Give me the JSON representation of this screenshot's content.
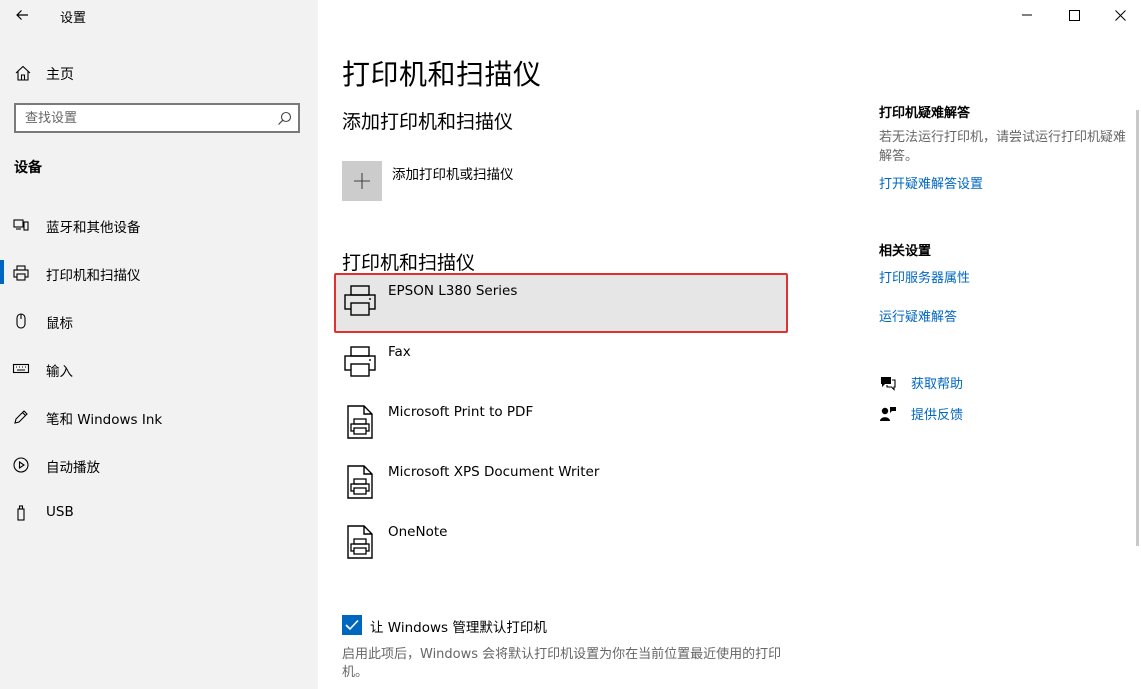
{
  "window": {
    "title": "设置"
  },
  "sidebar": {
    "home_label": "主页",
    "search_placeholder": "查找设置",
    "section_label": "设备",
    "items": [
      {
        "label": "蓝牙和其他设备",
        "icon": "bluetooth-icon"
      },
      {
        "label": "打印机和扫描仪",
        "icon": "printer-icon",
        "active": true
      },
      {
        "label": "鼠标",
        "icon": "mouse-icon"
      },
      {
        "label": "输入",
        "icon": "keyboard-icon"
      },
      {
        "label": "笔和 Windows Ink",
        "icon": "pen-icon"
      },
      {
        "label": "自动播放",
        "icon": "autoplay-icon"
      },
      {
        "label": "USB",
        "icon": "usb-icon"
      }
    ]
  },
  "main": {
    "title": "打印机和扫描仪",
    "add_section_title": "添加打印机和扫描仪",
    "add_button_label": "添加打印机或扫描仪",
    "list_section_title": "打印机和扫描仪",
    "printers": [
      {
        "name": "EPSON L380 Series",
        "icon": "printer-icon",
        "selected": true
      },
      {
        "name": "Fax",
        "icon": "printer-icon"
      },
      {
        "name": "Microsoft Print to PDF",
        "icon": "document-printer-icon"
      },
      {
        "name": "Microsoft XPS Document Writer",
        "icon": "document-printer-icon"
      },
      {
        "name": "OneNote",
        "icon": "document-printer-icon"
      }
    ],
    "default_printer_checkbox": {
      "label": "让 Windows 管理默认打印机",
      "checked": true
    },
    "default_printer_desc": "启用此项后，Windows 会将默认打印机设置为你在当前位置最近使用的打印机。"
  },
  "right_panel": {
    "troubleshoot_title": "打印机疑难解答",
    "troubleshoot_text": "若无法运行打印机，请尝试运行打印机疑难解答。",
    "troubleshoot_link": "打开疑难解答设置",
    "related_title": "相关设置",
    "related_links": [
      "打印服务器属性",
      "运行疑难解答"
    ],
    "help_label": "获取帮助",
    "feedback_label": "提供反馈"
  },
  "colors": {
    "accent": "#0067c0",
    "sidebar_bg": "#f2f2f2",
    "selection_border": "#e03030",
    "selection_bg": "#e6e6e6"
  }
}
